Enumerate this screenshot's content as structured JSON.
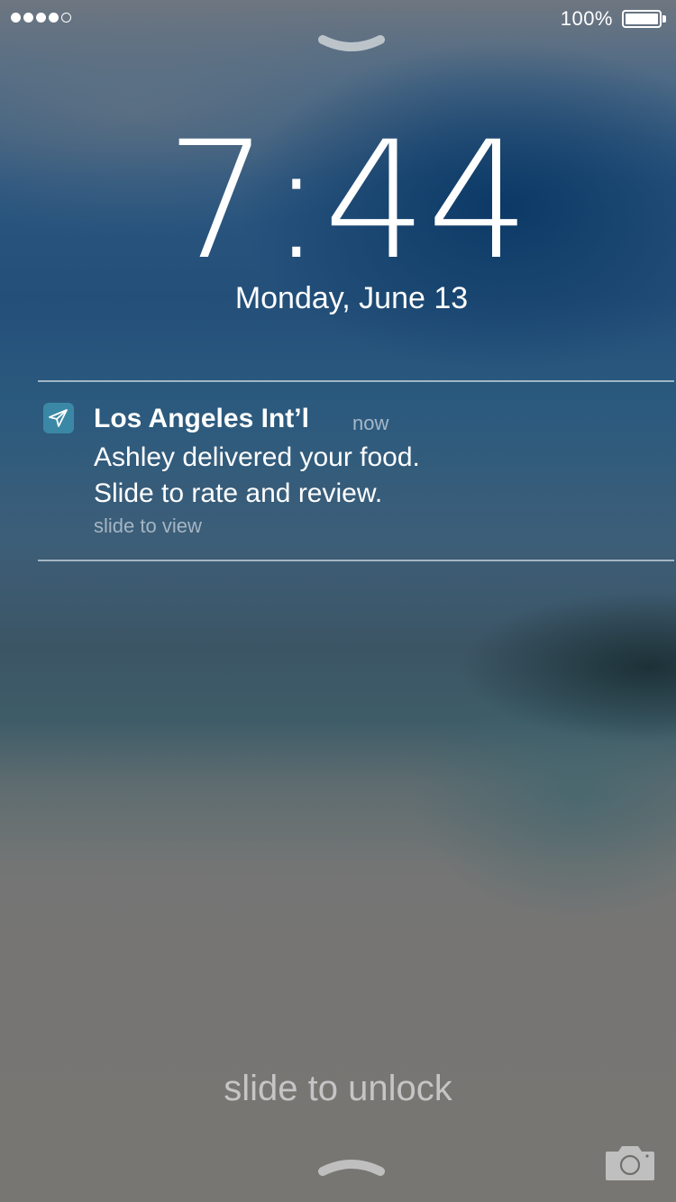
{
  "status_bar": {
    "signal_bars_filled": 4,
    "signal_bars_total": 5,
    "battery_percent_label": "100%",
    "battery_level": 1.0
  },
  "lock_screen": {
    "time": "7:44",
    "date": "Monday, June 13",
    "unlock_hint": "slide to unlock"
  },
  "notification": {
    "app_name": "Los Angeles Int’l",
    "time": "now",
    "body_line1": "Ashley delivered your food.",
    "body_line2": "Slide to rate and review.",
    "action_hint": "slide to view",
    "icon": "paper-plane-icon"
  },
  "icons": {
    "top_grabber": "chevron-grabber-icon",
    "bottom_grabber": "chevron-grabber-icon",
    "camera": "camera-icon"
  },
  "colors": {
    "app_icon_bg": "#3b88a6",
    "text": "#ffffff",
    "separator": "#c8d4de"
  }
}
